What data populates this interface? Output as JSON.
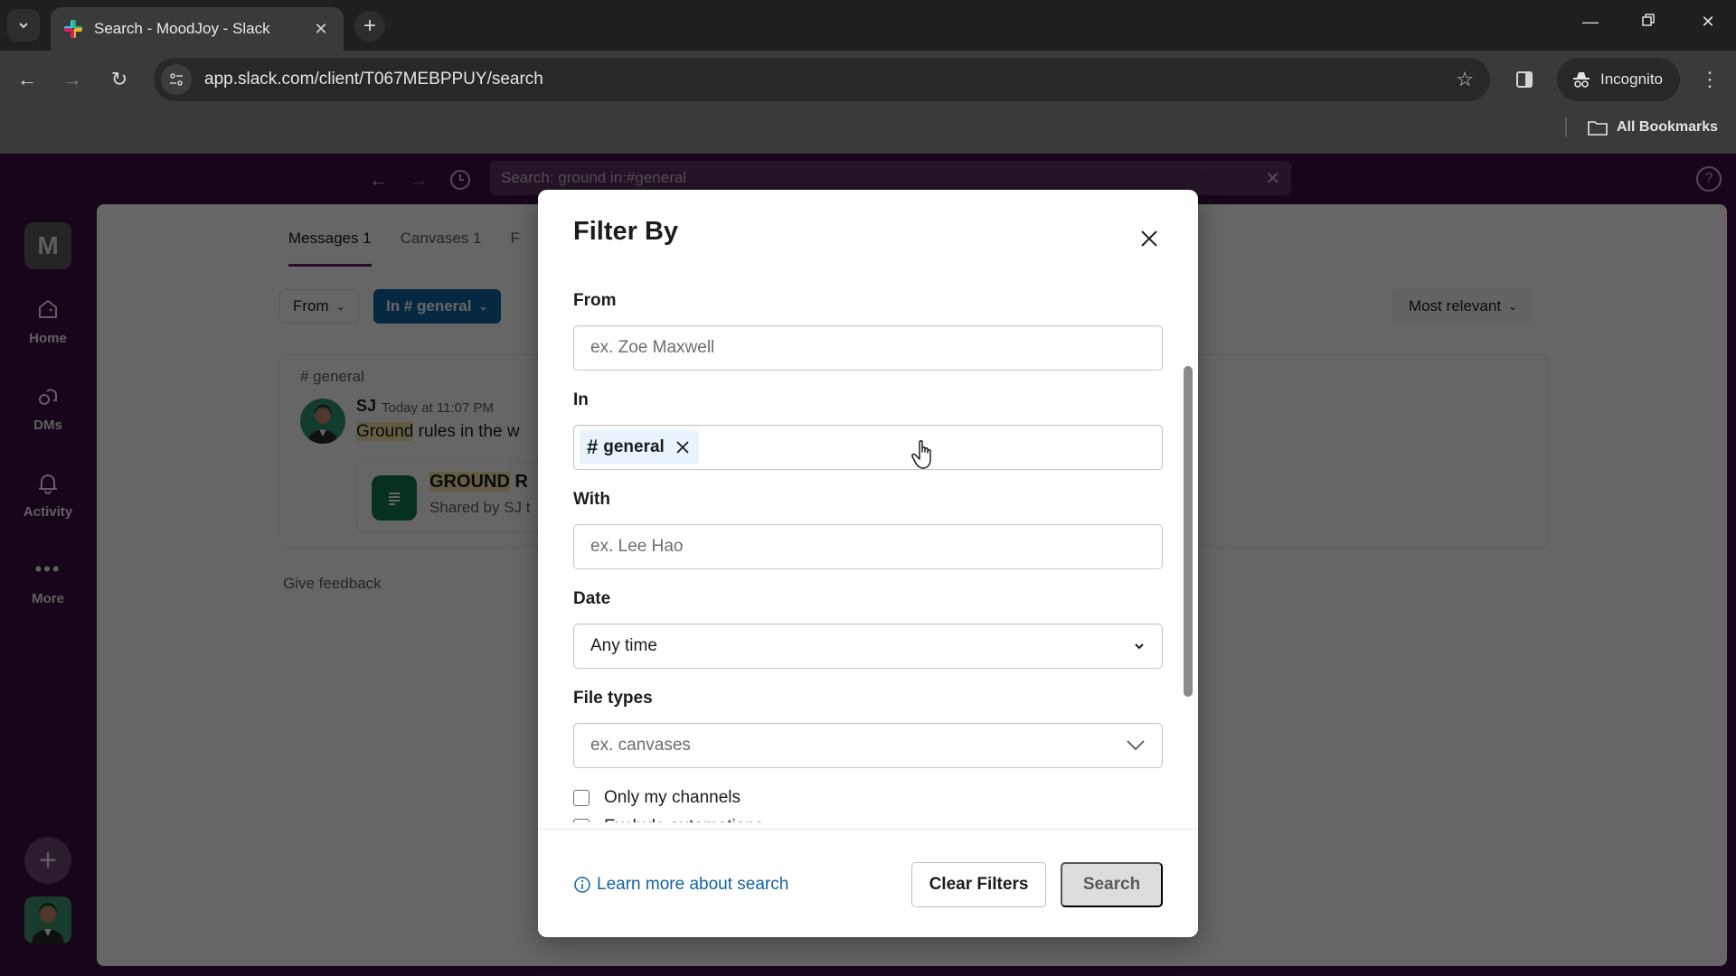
{
  "browser": {
    "tab_title": "Search - MoodJoy - Slack",
    "url": "app.slack.com/client/T067MEBPPUY/search",
    "profile_label": "Incognito",
    "bookmarks_label": "All Bookmarks"
  },
  "slack": {
    "search_query": "Search: ground in:#general",
    "workspace_initial": "M",
    "rail": [
      {
        "label": "Home",
        "icon": "home-icon"
      },
      {
        "label": "DMs",
        "icon": "dms-icon"
      },
      {
        "label": "Activity",
        "icon": "bell-icon"
      },
      {
        "label": "More",
        "icon": "more-icon"
      }
    ],
    "tabs": [
      {
        "label": "Messages 1",
        "active": true
      },
      {
        "label": "Canvases 1",
        "active": false
      },
      {
        "label": "F",
        "active": false
      }
    ],
    "filters": {
      "from_label": "From",
      "in_label": "In # general"
    },
    "sort_label": "Most relevant",
    "result": {
      "channel": "# general",
      "author": "SJ",
      "time": "Today at 11:07 PM",
      "text_highlight": "Ground",
      "text_rest": " rules in the w",
      "attachment_title_highlight": "GROUND",
      "attachment_title_rest": " R",
      "attachment_subtitle": "Shared by SJ t"
    },
    "feedback_label": "Give feedback"
  },
  "modal": {
    "title": "Filter By",
    "fields": {
      "from": {
        "label": "From",
        "placeholder": "ex. Zoe Maxwell"
      },
      "in": {
        "label": "In",
        "chip_hash": "#",
        "chip_label": "general"
      },
      "with": {
        "label": "With",
        "placeholder": "ex. Lee Hao"
      },
      "date": {
        "label": "Date",
        "value": "Any time"
      },
      "file_types": {
        "label": "File types",
        "placeholder": "ex. canvases"
      }
    },
    "checkboxes": [
      {
        "label": "Only my channels",
        "checked": false
      },
      {
        "label": "Exclude automations",
        "checked": false
      }
    ],
    "learn_more": "Learn more about search",
    "clear_button": "Clear Filters",
    "search_button": "Search"
  }
}
